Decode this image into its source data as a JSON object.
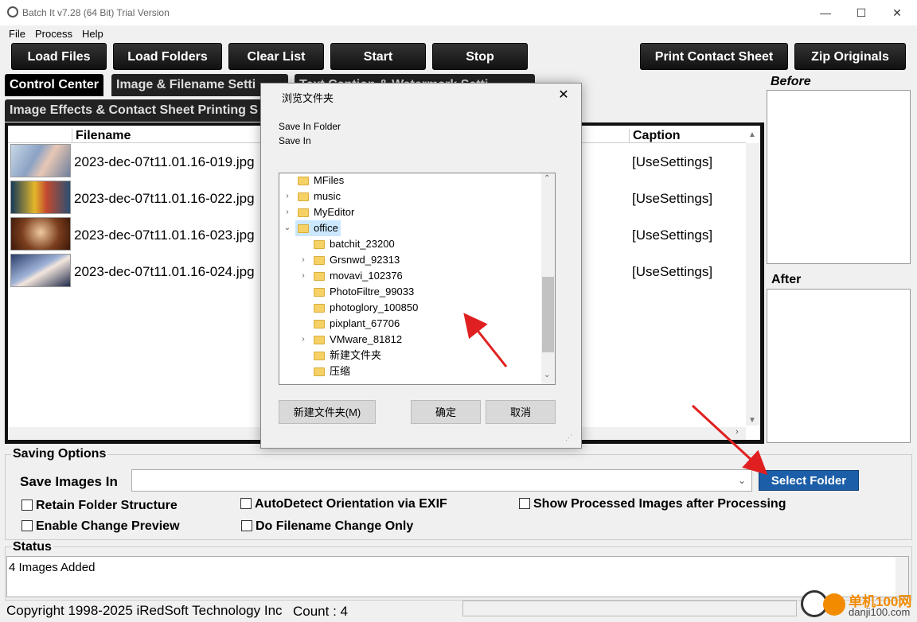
{
  "window": {
    "title": "Batch It v7.28 (64 Bit) Trial Version",
    "min": "—",
    "max": "☐",
    "close": "✕"
  },
  "menu": [
    "File",
    "Process",
    "Help"
  ],
  "toolbar": {
    "load_files": "Load Files",
    "load_folders": "Load Folders",
    "clear_list": "Clear List",
    "start": "Start",
    "stop": "Stop",
    "print_contact_sheet": "Print Contact Sheet",
    "zip_originals": "Zip Originals"
  },
  "tabs": {
    "control_center": "Control Center",
    "image_filename": "Image & Filename Setti",
    "text_caption": "Text Caption & Watermark Setti",
    "image_effects": "Image Effects & Contact Sheet Printing S"
  },
  "list": {
    "headers": {
      "filename": "Filename",
      "caption": "Caption"
    },
    "rows": [
      {
        "filename": "2023-dec-07t11.01.16-019.jpg",
        "caption": "[UseSettings]"
      },
      {
        "filename": "2023-dec-07t11.01.16-022.jpg",
        "caption": "[UseSettings]"
      },
      {
        "filename": "2023-dec-07t11.01.16-023.jpg",
        "caption": "[UseSettings]"
      },
      {
        "filename": "2023-dec-07t11.01.16-024.jpg",
        "caption": "[UseSettings]"
      }
    ]
  },
  "preview": {
    "before": "Before",
    "after": "After"
  },
  "saving": {
    "group_label": "Saving Options",
    "save_label": "Save Images In",
    "save_value": "",
    "select_folder": "Select Folder",
    "options": {
      "retain": "Retain Folder Structure",
      "enable_preview": "Enable Change Preview",
      "autodetect": "AutoDetect Orientation via EXIF",
      "filename_only": "Do Filename Change Only",
      "show_processed": "Show Processed Images after Processing"
    }
  },
  "status": {
    "label": "Status",
    "text": "4 Images Added"
  },
  "footer": {
    "copyright": "Copyright 1998-2025 iRedSoft Technology Inc",
    "count": "Count : 4"
  },
  "dialog": {
    "title": "浏览文件夹",
    "close": "✕",
    "line1": "Save In Folder",
    "line2": "Save In",
    "tree": [
      {
        "label": "MFiles",
        "level": 1,
        "expander": ""
      },
      {
        "label": "music",
        "level": 1,
        "expander": "›"
      },
      {
        "label": "MyEditor",
        "level": 1,
        "expander": "›"
      },
      {
        "label": "office",
        "level": 1,
        "expander": "⌄",
        "selected": true
      },
      {
        "label": "batchit_23200",
        "level": 2,
        "expander": ""
      },
      {
        "label": "Grsnwd_92313",
        "level": 2,
        "expander": "›"
      },
      {
        "label": "movavi_102376",
        "level": 2,
        "expander": "›"
      },
      {
        "label": "PhotoFiltre_99033",
        "level": 2,
        "expander": ""
      },
      {
        "label": "photoglory_100850",
        "level": 2,
        "expander": ""
      },
      {
        "label": "pixplant_67706",
        "level": 2,
        "expander": ""
      },
      {
        "label": "VMware_81812",
        "level": 2,
        "expander": "›"
      },
      {
        "label": "新建文件夹",
        "level": 2,
        "expander": ""
      },
      {
        "label": "压缩",
        "level": 2,
        "expander": ""
      }
    ],
    "new_folder": "新建文件夹(M)",
    "ok": "确定",
    "cancel": "取消"
  },
  "watermark": {
    "site_cn": "单机100网",
    "site_url": "danji100.com"
  },
  "colors": {
    "accent": "#1c5ea8",
    "toolbar": "#222222",
    "arrow": "#e02020"
  }
}
